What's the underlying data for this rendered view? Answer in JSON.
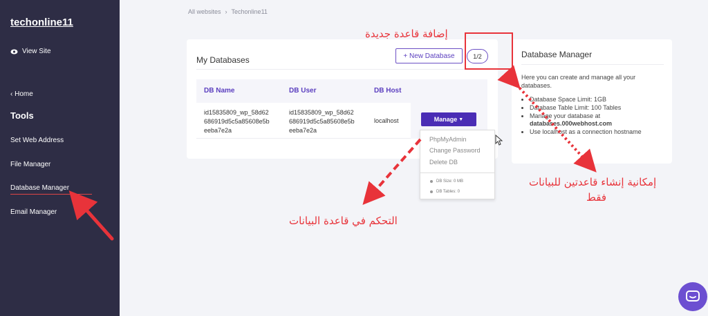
{
  "sidebar": {
    "site_name": "techonline11",
    "view_site": "View Site",
    "home": "Home",
    "tools_heading": "Tools",
    "items": [
      {
        "label": "Set Web Address"
      },
      {
        "label": "File Manager"
      },
      {
        "label": "Database Manager"
      },
      {
        "label": "Email Manager"
      }
    ]
  },
  "breadcrumb": {
    "root": "All websites",
    "current": "Techonline11"
  },
  "databases": {
    "title": "My Databases",
    "new_button": "+ New Database",
    "count": "1/2",
    "columns": [
      "DB Name",
      "DB User",
      "DB Host"
    ],
    "row": {
      "name_lines": [
        "id15835809_wp_58d62",
        "686919d5c5a85608e5b",
        "eeba7e2a"
      ],
      "user_lines": [
        "id15835809_wp_58d62",
        "686919d5c5a85608e5b",
        "eeba7e2a"
      ],
      "host": "localhost",
      "manage_label": "Manage"
    }
  },
  "dropdown": {
    "items": [
      "PhpMyAdmin",
      "Change Password",
      "Delete DB"
    ],
    "db_size": "DB Size: 0 MB",
    "db_tables": "DB Tables: 0"
  },
  "manager": {
    "title": "Database Manager",
    "desc": "Here you can create and manage all your databases.",
    "space_limit": "Database Space Limit: 1GB",
    "table_limit": "Database Table Limit: 100 Tables",
    "manage_at": "Manage your database at",
    "manage_host": "databases.000webhost.com",
    "localhost_note": "Use localhost as a connection hostname"
  },
  "annotations": {
    "add_db": "إضافة قاعدة جديدة",
    "two_db_line1": "إمكانية إنشاء قاعدتين للبيانات",
    "two_db_line2": "فقط",
    "control_db": "التحكم في قاعدة البيانات"
  },
  "colors": {
    "accent": "#4a2db5",
    "sidebar": "#2e2d45",
    "annotation": "#e8333a"
  }
}
